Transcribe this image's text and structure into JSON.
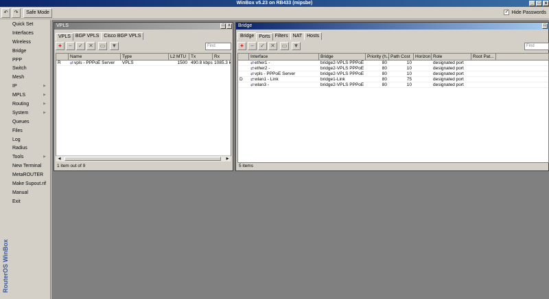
{
  "app": {
    "title": "WinBox v5.23 on RB433 (mipsbe)",
    "min_label": "_",
    "max_label": "□",
    "close_label": "x"
  },
  "toolbar": {
    "undo_icon": "↶",
    "redo_icon": "↷",
    "safe_mode_label": "Safe Mode",
    "hide_passwords_label": "Hide Passwords",
    "hide_passwords_checked": "✓"
  },
  "sidebar": {
    "items": [
      {
        "label": "Quick Set",
        "arrow": ""
      },
      {
        "label": "Interfaces",
        "arrow": ""
      },
      {
        "label": "Wireless",
        "arrow": ""
      },
      {
        "label": "Bridge",
        "arrow": ""
      },
      {
        "label": "PPP",
        "arrow": ""
      },
      {
        "label": "Switch",
        "arrow": ""
      },
      {
        "label": "Mesh",
        "arrow": ""
      },
      {
        "label": "IP",
        "arrow": "▶"
      },
      {
        "label": "MPLS",
        "arrow": "▶"
      },
      {
        "label": "Routing",
        "arrow": "▶"
      },
      {
        "label": "System",
        "arrow": "▶"
      },
      {
        "label": "Queues",
        "arrow": ""
      },
      {
        "label": "Files",
        "arrow": ""
      },
      {
        "label": "Log",
        "arrow": ""
      },
      {
        "label": "Radius",
        "arrow": ""
      },
      {
        "label": "Tools",
        "arrow": "▶"
      },
      {
        "label": "New Terminal",
        "arrow": ""
      },
      {
        "label": "MetaROUTER",
        "arrow": ""
      },
      {
        "label": "Make Supout.rif",
        "arrow": ""
      },
      {
        "label": "Manual",
        "arrow": ""
      },
      {
        "label": "Exit",
        "arrow": ""
      }
    ],
    "brand": "RouterOS WinBox"
  },
  "vpls_window": {
    "title": "VPLS",
    "tabs": [
      "VPLS",
      "BGP VPLS",
      "Cisco BGP VPLS"
    ],
    "find_placeholder": "Find",
    "columns": [
      "",
      "Name",
      "Type",
      "L2 MTU",
      "Tx",
      "Rx"
    ],
    "rows": [
      {
        "flag": "R",
        "icon": "⇄",
        "name": "vpls - PPPoE Server",
        "type": "VPLS",
        "l2mtu": "1500",
        "tx": "490.8 kbps",
        "rx": "1085.3 k"
      }
    ],
    "status": "1 item out of 9"
  },
  "bridge_window": {
    "title": "Bridge",
    "tabs": [
      "Bridge",
      "Ports",
      "Filters",
      "NAT",
      "Hosts"
    ],
    "find_placeholder": "Find",
    "columns": [
      "",
      "Interface",
      "Bridge",
      "Priority (h...",
      "Path Cost",
      "Horizon",
      "Role",
      "Root Pat..."
    ],
    "rows": [
      {
        "flag": "",
        "icon": "⇄",
        "iface": "ether1 -",
        "bridge": "bridge2-VPLS PPPoE",
        "priority": "80",
        "cost": "10",
        "horizon": "",
        "role": "designated port",
        "root": ""
      },
      {
        "flag": "",
        "icon": "⇄",
        "iface": "ether2 -",
        "bridge": "bridge2-VPLS PPPoE",
        "priority": "80",
        "cost": "10",
        "horizon": "",
        "role": "designated port",
        "root": ""
      },
      {
        "flag": "",
        "icon": "⇄",
        "iface": "vpls - PPPoE Server",
        "bridge": "bridge2-VPLS PPPoE",
        "priority": "80",
        "cost": "10",
        "horizon": "",
        "role": "designated port",
        "root": ""
      },
      {
        "flag": "D",
        "icon": "⇄",
        "iface": "wlan1 - Link",
        "bridge": "bridge1-Link",
        "priority": "80",
        "cost": "75",
        "horizon": "",
        "role": "designated port",
        "root": ""
      },
      {
        "flag": "",
        "icon": "⇄",
        "iface": "wlan3 -",
        "bridge": "bridge2-VPLS PPPoE",
        "priority": "80",
        "cost": "10",
        "horizon": "",
        "role": "designated port",
        "root": ""
      }
    ],
    "status": "5 items"
  },
  "icons": {
    "add": "+",
    "remove": "−",
    "enable": "✓",
    "disable": "✕",
    "comment": "▭",
    "filter": "▼",
    "scroll_left": "◀",
    "scroll_right": "▶"
  }
}
